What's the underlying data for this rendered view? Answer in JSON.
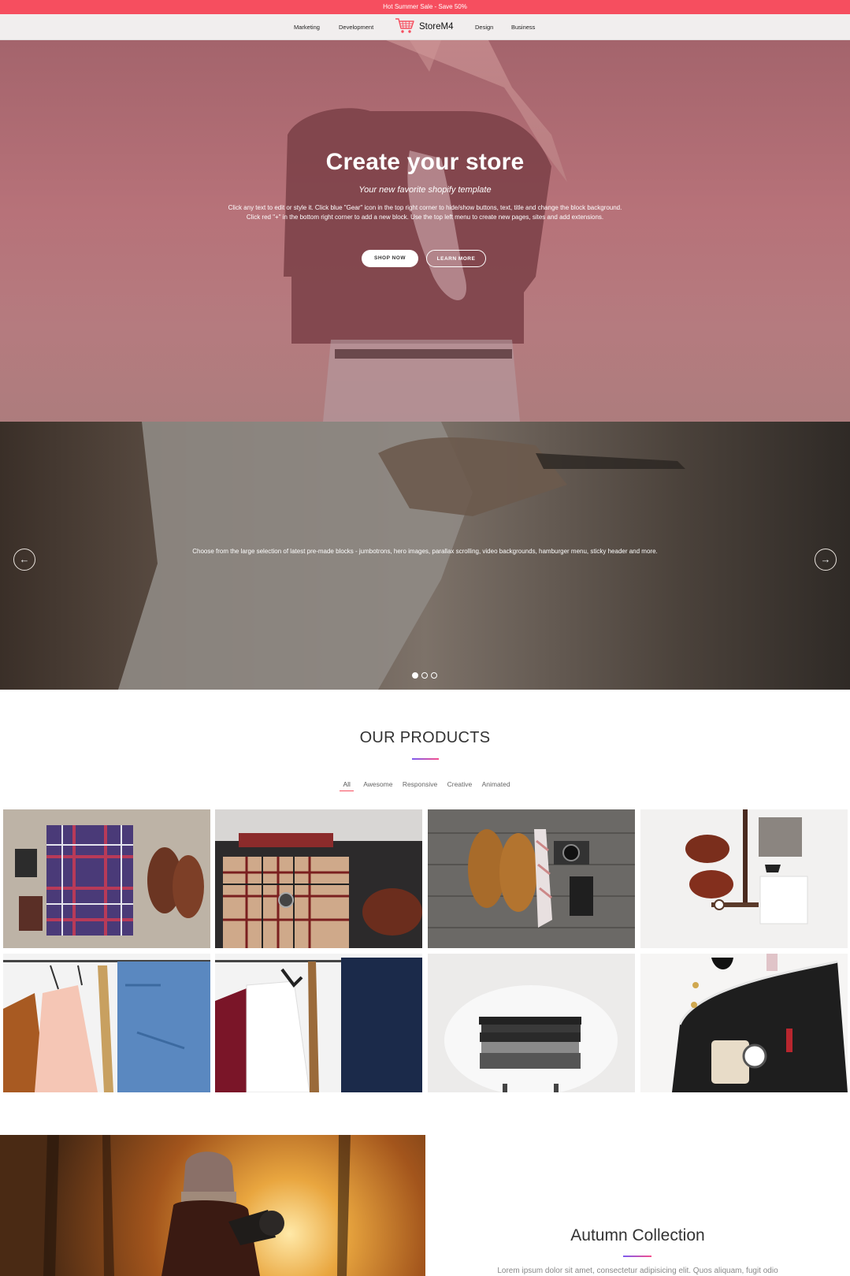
{
  "promo": {
    "text": "Hot Summer Sale - Save 50%"
  },
  "nav": {
    "links": [
      "Marketing",
      "Development",
      "Design",
      "Business"
    ],
    "brand": "StoreM4",
    "brand_icon": "cart-icon"
  },
  "hero": {
    "title": "Create your store",
    "subtitle": "Your new favorite shopify template",
    "text": "Click any text to edit or style it. Click blue \"Gear\" icon in the top right corner to hide/show buttons, text, title and change the block background. Click red \"+\" in the bottom right corner to add a new block. Use the top left menu to create new pages, sites and add extensions.",
    "primary_button": "SHOP NOW",
    "secondary_button": "LEARN MORE"
  },
  "slider": {
    "text": "Choose from the large selection of latest pre-made blocks - jumbotrons, hero images, parallax scrolling, video backgrounds, hamburger menu, sticky header and more.",
    "prev_icon": "arrow-left-icon",
    "next_icon": "arrow-right-icon",
    "slide_count": 3,
    "active_slide": 1
  },
  "products": {
    "title": "OUR PRODUCTS",
    "filters": [
      "All",
      "Awesome",
      "Responsive",
      "Creative",
      "Animated"
    ],
    "active_filter": "All",
    "items": [
      {
        "image": "plaid-shirt-shoes-flatlay"
      },
      {
        "image": "suitcase-clothes-shoes"
      },
      {
        "image": "boots-tie-camera-wood"
      },
      {
        "image": "boots-belt-tshirt-flatlay"
      },
      {
        "image": "rack-jacket-jeans"
      },
      {
        "image": "rack-blazer-belt-jeans"
      },
      {
        "image": "folded-clothes-chair"
      },
      {
        "image": "bag-watch-accessories"
      }
    ]
  },
  "autumn": {
    "title": "Autumn Collection",
    "text": "Lorem ipsum dolor sit amet, consectetur adipisicing elit. Quos aliquam, fugit odio"
  },
  "colors": {
    "promo_bar": "#f64e5f",
    "accent_gradient_start": "#7c5cf0",
    "accent_gradient_end": "#f64e8c"
  }
}
